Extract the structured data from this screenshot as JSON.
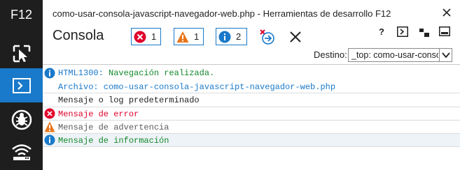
{
  "rail": {
    "title": "F12",
    "tools": [
      {
        "name": "dom-explorer",
        "icon": "pointer-select-icon"
      },
      {
        "name": "console",
        "icon": "console-icon",
        "active": true
      },
      {
        "name": "debugger",
        "icon": "bug-icon"
      },
      {
        "name": "network",
        "icon": "wifi-network-icon"
      }
    ]
  },
  "window": {
    "title": "como-usar-consola-javascript-navegador-web.php - Herramientas de desarrollo F12",
    "close_icon": "close-icon"
  },
  "toolbar": {
    "title": "Consola",
    "errors_count": "1",
    "warnings_count": "1",
    "info_count": "2",
    "help_label": "?",
    "target_label": "Destino:",
    "target_value": "_top: como-usar-consola-javascript-navegador-web.php"
  },
  "messages": {
    "m1_code": "HTML1300:",
    "m1_text": "Navegación realizada.",
    "m1_file": "Archivo: como-usar-consola-javascript-navegador-web.php",
    "m2_text": "Mensaje o log predeterminado",
    "m3_text": "Mensaje de error",
    "m4_text": "Mensaje de advertencia",
    "m5_text": "Mensaje de información"
  },
  "colors": {
    "rail_bg": "#1e1e1e",
    "active_tool": "#1979ca",
    "error": "#e0002b",
    "warning": "#e8751a",
    "info": "#1979ca",
    "success_text": "#13882c"
  }
}
